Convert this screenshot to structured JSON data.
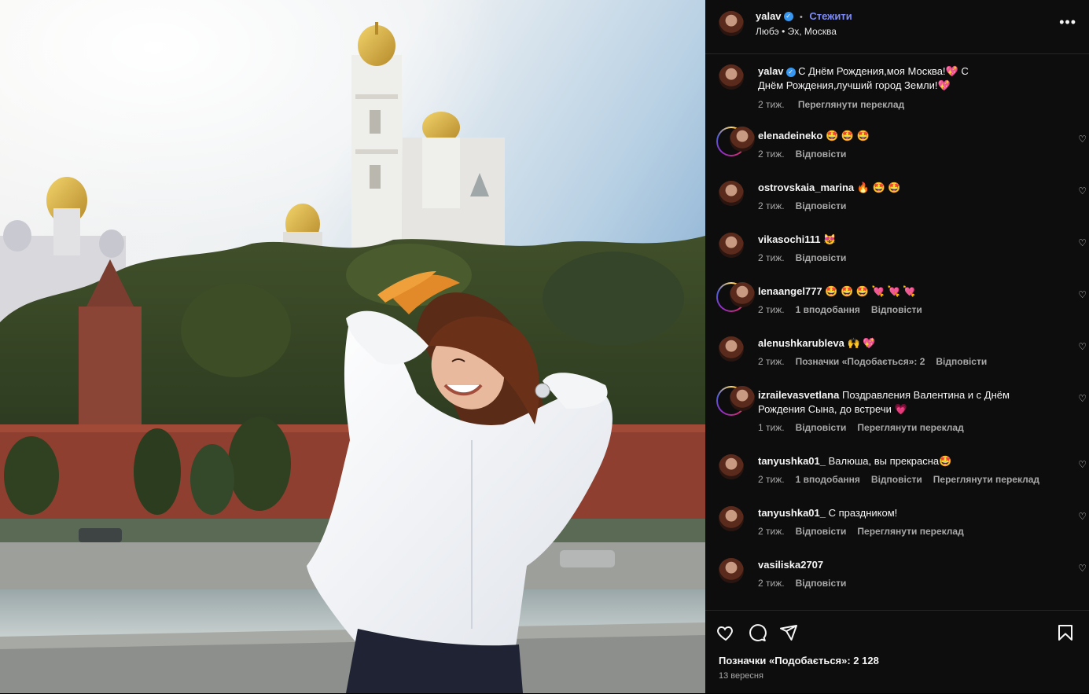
{
  "post": {
    "author": "yalav",
    "separator": "•",
    "follow_label": "Стежити",
    "music": "Любэ • Эх, Москва",
    "more": "•••",
    "likes": "Позначки «Подобається»: 2 128",
    "date": "13 вересня"
  },
  "caption": {
    "user": "yalav",
    "text": "С Днём Рождения,моя Москва!💖 С Днём Рождения,лучший город Земли!💖",
    "time": "2 тиж.",
    "translate": "Переглянути переклад"
  },
  "comments": [
    {
      "user": "elenadeineko",
      "text": "🤩 🤩 🤩",
      "time": "2 тиж.",
      "likes": "",
      "reply": "Відповісти",
      "translate": "",
      "story": true
    },
    {
      "user": "ostrovskaia_marina",
      "text": "🔥 🤩 🤩",
      "time": "2 тиж.",
      "likes": "",
      "reply": "Відповісти",
      "translate": "",
      "story": false
    },
    {
      "user": "vikasochi111",
      "text": "😻",
      "time": "2 тиж.",
      "likes": "",
      "reply": "Відповісти",
      "translate": "",
      "story": false
    },
    {
      "user": "lenaangel777",
      "text": "🤩 🤩 🤩 💘 💘 💘",
      "time": "2 тиж.",
      "likes": "1 вподобання",
      "reply": "Відповісти",
      "translate": "",
      "story": true
    },
    {
      "user": "alenushkarubleva",
      "text": "🙌 💖",
      "time": "2 тиж.",
      "likes": "Позначки «Подобається»: 2",
      "reply": "Відповісти",
      "translate": "",
      "story": false
    },
    {
      "user": "izrailevasvetlana",
      "text": "Поздравления Валентина и с Днём Рождения Сына, до встречи 💗",
      "time": "1 тиж.",
      "likes": "",
      "reply": "Відповісти",
      "translate": "Переглянути переклад",
      "story": true
    },
    {
      "user": "tanyushka01_",
      "text": "Валюша, вы прекрасна🤩",
      "time": "2 тиж.",
      "likes": "1 вподобання",
      "reply": "Відповісти",
      "translate": "Переглянути переклад",
      "story": false
    },
    {
      "user": "tanyushka01_",
      "text": "С праздником!",
      "time": "2 тиж.",
      "likes": "",
      "reply": "Відповісти",
      "translate": "Переглянути переклад",
      "story": false
    },
    {
      "user": "vasiliska2707",
      "text": "",
      "time": "2 тиж.",
      "likes": "",
      "reply": "Відповісти",
      "translate": "",
      "story": false
    }
  ],
  "icons": {
    "like": "heart-icon",
    "comment": "comment-icon",
    "share": "send-icon",
    "save": "bookmark-icon",
    "verified": "verified-badge-icon",
    "options": "more-options-icon"
  },
  "colors": {
    "panel_bg": "#0d0d0d",
    "follow": "#7e8cf7",
    "verified": "#3897f0",
    "muted": "#a8a8a8"
  }
}
